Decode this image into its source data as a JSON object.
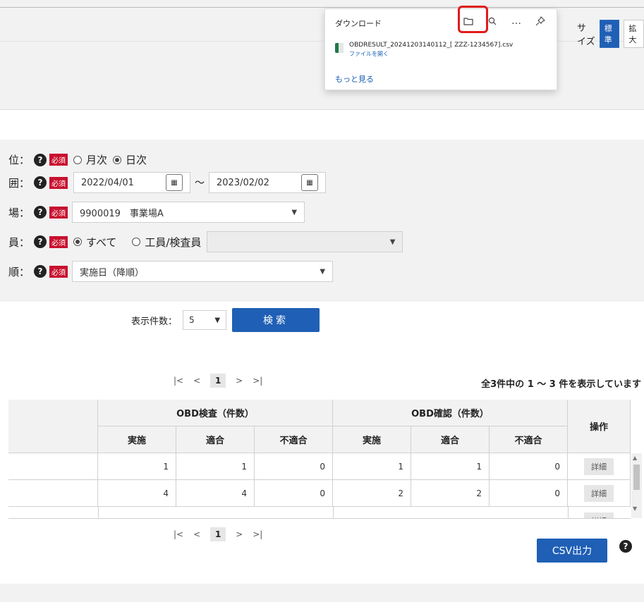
{
  "font_size": {
    "label": "サイズ",
    "standard": "標準",
    "large": "拡大"
  },
  "download_panel": {
    "title": "ダウンロード",
    "icons": [
      "folder-icon",
      "search-icon",
      "more-icon",
      "pin-icon"
    ],
    "more_glyph": "…",
    "file_name": "OBDRESULT_20241203140112_[ ZZZ-1234567].csv",
    "open_file": "ファイルを開く",
    "see_more": "もっと見る"
  },
  "form": {
    "unit": {
      "label": "位：",
      "required": "必須",
      "option_month": "月次",
      "option_day": "日次",
      "selected": "日次"
    },
    "range": {
      "label": "囲：",
      "required": "必須",
      "from": "2022/04/01",
      "tilde": "～",
      "to": "2023/02/02"
    },
    "site": {
      "label": "場：",
      "required": "必須",
      "value": "9900019　事業場A"
    },
    "staff": {
      "label": "員：",
      "required": "必須",
      "option_all": "すべて",
      "option_worker": "工員/検査員",
      "selected": "すべて"
    },
    "order": {
      "label": "順：",
      "required": "必須",
      "value": "実施日（降順）"
    },
    "page_size_label": "表示件数：",
    "page_size_value": "5",
    "search_button": "検索"
  },
  "pagination": {
    "first": "|<",
    "prev": "<",
    "current": "1",
    "next": ">",
    "last": ">|"
  },
  "summary": "全3件中の 1 ～ 3 件を表示しています",
  "table": {
    "group_obd_check": "OBD検査（件数）",
    "group_obd_confirm": "OBD確認（件数）",
    "operation": "操作",
    "sub_headers": [
      "実施",
      "適合",
      "不適合",
      "実施",
      "適合",
      "不適合"
    ],
    "rows": [
      {
        "values": [
          "1",
          "1",
          "0",
          "1",
          "1",
          "0"
        ],
        "action": "詳細"
      },
      {
        "values": [
          "4",
          "4",
          "0",
          "2",
          "2",
          "0"
        ],
        "action": "詳細"
      },
      {
        "values": [
          "",
          "",
          "",
          "",
          "",
          ""
        ],
        "action": "詳細"
      }
    ]
  },
  "csv_button": "CSV出力",
  "help_glyph": "?"
}
